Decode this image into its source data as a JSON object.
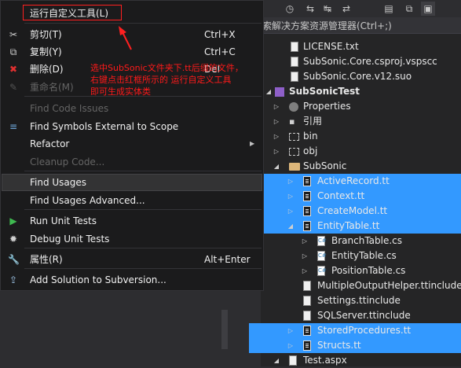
{
  "solution_explorer": {
    "toolbar_buttons": [
      "history-icon",
      "back-icon",
      "forward-icon",
      "refresh-icon",
      "properties-icon",
      "sync-icon"
    ],
    "search_placeholder": "索解决方案资源管理器(Ctrl+;)",
    "items": [
      {
        "label": "LICENSE.txt",
        "type": "file",
        "expander": "",
        "selected": false
      },
      {
        "label": "SubSonic.Core.csproj.vspscc",
        "type": "file",
        "expander": "",
        "selected": false
      },
      {
        "label": "SubSonic.Core.v12.suo",
        "type": "file",
        "expander": "",
        "selected": false
      },
      {
        "label": "SubSonicTest",
        "type": "project",
        "expander": "expanded",
        "selected": false
      },
      {
        "label": "Properties",
        "type": "gear",
        "expander": "collapsed",
        "selected": false
      },
      {
        "label": "引用",
        "type": "reference",
        "expander": "collapsed",
        "selected": false
      },
      {
        "label": "bin",
        "type": "folder-hidden",
        "expander": "collapsed",
        "selected": false
      },
      {
        "label": "obj",
        "type": "folder-hidden",
        "expander": "collapsed",
        "selected": false
      },
      {
        "label": "SubSonic",
        "type": "folder",
        "expander": "expanded",
        "selected": false
      },
      {
        "label": "ActiveRecord.tt",
        "type": "tt",
        "expander": "collapsed",
        "selected": true
      },
      {
        "label": "Context.tt",
        "type": "tt",
        "expander": "collapsed",
        "selected": true
      },
      {
        "label": "CreateModel.tt",
        "type": "tt",
        "expander": "collapsed",
        "selected": true
      },
      {
        "label": "EntityTable.tt",
        "type": "tt",
        "expander": "expanded",
        "selected": true
      },
      {
        "label": "BranchTable.cs",
        "type": "cs",
        "expander": "collapsed",
        "selected": false
      },
      {
        "label": "EntityTable.cs",
        "type": "cs",
        "expander": "collapsed",
        "selected": false
      },
      {
        "label": "PositionTable.cs",
        "type": "cs",
        "expander": "collapsed",
        "selected": false
      },
      {
        "label": "MultipleOutputHelper.ttinclude",
        "type": "file",
        "expander": "",
        "selected": false
      },
      {
        "label": "Settings.ttinclude",
        "type": "file",
        "expander": "",
        "selected": false
      },
      {
        "label": "SQLServer.ttinclude",
        "type": "file",
        "expander": "",
        "selected": false
      },
      {
        "label": "StoredProcedures.tt",
        "type": "tt",
        "expander": "collapsed",
        "selected": true
      },
      {
        "label": "Structs.tt",
        "type": "tt",
        "expander": "collapsed",
        "selected": true
      },
      {
        "label": "Test.aspx",
        "type": "file",
        "expander": "expanded",
        "selected": false
      }
    ]
  },
  "context_menu": {
    "items": [
      {
        "label": "运行自定义工具(L)",
        "shortcut": "",
        "icon": "",
        "disabled": false,
        "submenu": false
      },
      {
        "label": "剪切(T)",
        "shortcut": "Ctrl+X",
        "icon": "scissors-icon",
        "disabled": false,
        "submenu": false
      },
      {
        "label": "复制(Y)",
        "shortcut": "Ctrl+C",
        "icon": "copy-icon",
        "disabled": false,
        "submenu": false
      },
      {
        "label": "删除(D)",
        "shortcut": "Del",
        "icon": "delete-icon",
        "disabled": false,
        "submenu": false
      },
      {
        "label": "重命名(M)",
        "shortcut": "",
        "icon": "rename-icon",
        "disabled": true,
        "submenu": false
      },
      {
        "label": "Find Code Issues",
        "shortcut": "",
        "icon": "",
        "disabled": true,
        "submenu": false
      },
      {
        "label": "Find Symbols External to Scope",
        "shortcut": "",
        "icon": "symbols-icon",
        "disabled": false,
        "submenu": false
      },
      {
        "label": "Refactor",
        "shortcut": "",
        "icon": "",
        "disabled": false,
        "submenu": true
      },
      {
        "label": "Cleanup Code...",
        "shortcut": "",
        "icon": "",
        "disabled": true,
        "submenu": false
      },
      {
        "label": "Find Usages",
        "shortcut": "",
        "icon": "",
        "disabled": false,
        "submenu": false,
        "hover": true
      },
      {
        "label": "Find Usages Advanced...",
        "shortcut": "",
        "icon": "",
        "disabled": false,
        "submenu": false
      },
      {
        "label": "Run Unit Tests",
        "shortcut": "",
        "icon": "run-tests-icon",
        "disabled": false,
        "submenu": false
      },
      {
        "label": "Debug Unit Tests",
        "shortcut": "",
        "icon": "bug-icon",
        "disabled": false,
        "submenu": false
      },
      {
        "label": "属性(R)",
        "shortcut": "Alt+Enter",
        "icon": "wrench-icon",
        "disabled": false,
        "submenu": false
      },
      {
        "label": "Add Solution to Subversion...",
        "shortcut": "",
        "icon": "subversion-icon",
        "disabled": false,
        "submenu": false
      }
    ]
  },
  "annotation": {
    "lines": [
      "选中SubSonic文件夹下.tt后缀的文件，",
      "右键点击红框所示的 运行自定义工具",
      "即可生成实体类"
    ],
    "color": "#ff1a1a"
  },
  "colors": {
    "menu_bg": "#1b1b1c",
    "selection": "#3399ff",
    "annotation_red": "#ff2020"
  }
}
